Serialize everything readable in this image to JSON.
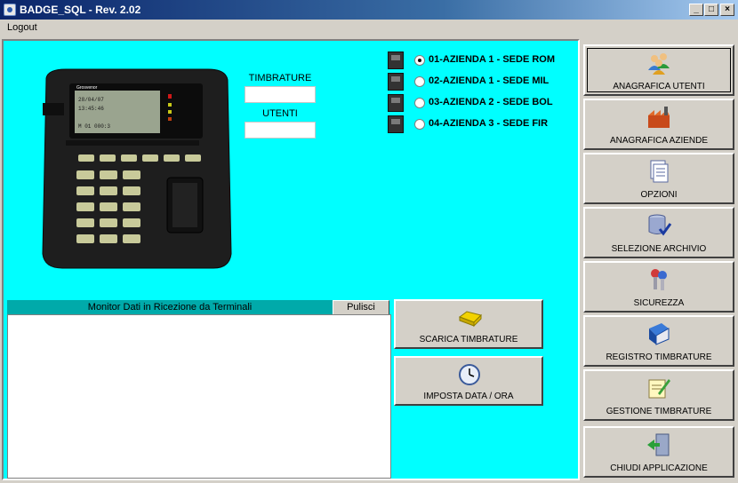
{
  "window": {
    "title": "BADGE_SQL - Rev. 2.02"
  },
  "menu": {
    "logout": "Logout"
  },
  "labels": {
    "timbrature": "TIMBRATURE",
    "utenti": "UTENTI"
  },
  "terminal": {
    "brand": "Grosvenor",
    "screen_lines": [
      "28/04/07",
      "13:45:46",
      "M 01 000:3"
    ],
    "keys": [
      "F1",
      "F2",
      "F3",
      "F4",
      "F5",
      "F6"
    ],
    "status_lights": [
      "Presen",
      "Cod/Tool",
      "Ril/Dimis",
      "Inet Cours"
    ]
  },
  "aziende": [
    {
      "label": "01-AZIENDA 1 - SEDE ROM",
      "selected": true
    },
    {
      "label": "02-AZIENDA 1 - SEDE MIL",
      "selected": false
    },
    {
      "label": "03-AZIENDA 2 - SEDE BOL",
      "selected": false
    },
    {
      "label": "04-AZIENDA 3 - SEDE FIR",
      "selected": false
    }
  ],
  "monitor": {
    "header": "Monitor Dati in Ricezione da Terminali",
    "clear_label": "Pulisci"
  },
  "actions": {
    "scarica": "SCARICA TIMBRATURE",
    "imposta": "IMPOSTA DATA / ORA"
  },
  "sidebar": {
    "items": [
      {
        "label": "ANAGRAFICA UTENTI",
        "icon": "users-icon"
      },
      {
        "label": "ANAGRAFICA AZIENDE",
        "icon": "factory-icon"
      },
      {
        "label": "OPZIONI",
        "icon": "documents-icon"
      },
      {
        "label": "SELEZIONE ARCHIVIO",
        "icon": "database-check-icon"
      },
      {
        "label": "SICUREZZA",
        "icon": "keys-icon"
      },
      {
        "label": "REGISTRO TIMBRATURE",
        "icon": "book-icon"
      },
      {
        "label": "GESTIONE TIMBRATURE",
        "icon": "notepad-pencil-icon"
      },
      {
        "label": "CHIUDI APPLICAZIONE",
        "icon": "exit-door-icon"
      }
    ]
  },
  "colors": {
    "content_bg": "#00ffff",
    "monitor_header": "#00aaaa",
    "title_start": "#0a246a",
    "title_end": "#a6caf0"
  }
}
